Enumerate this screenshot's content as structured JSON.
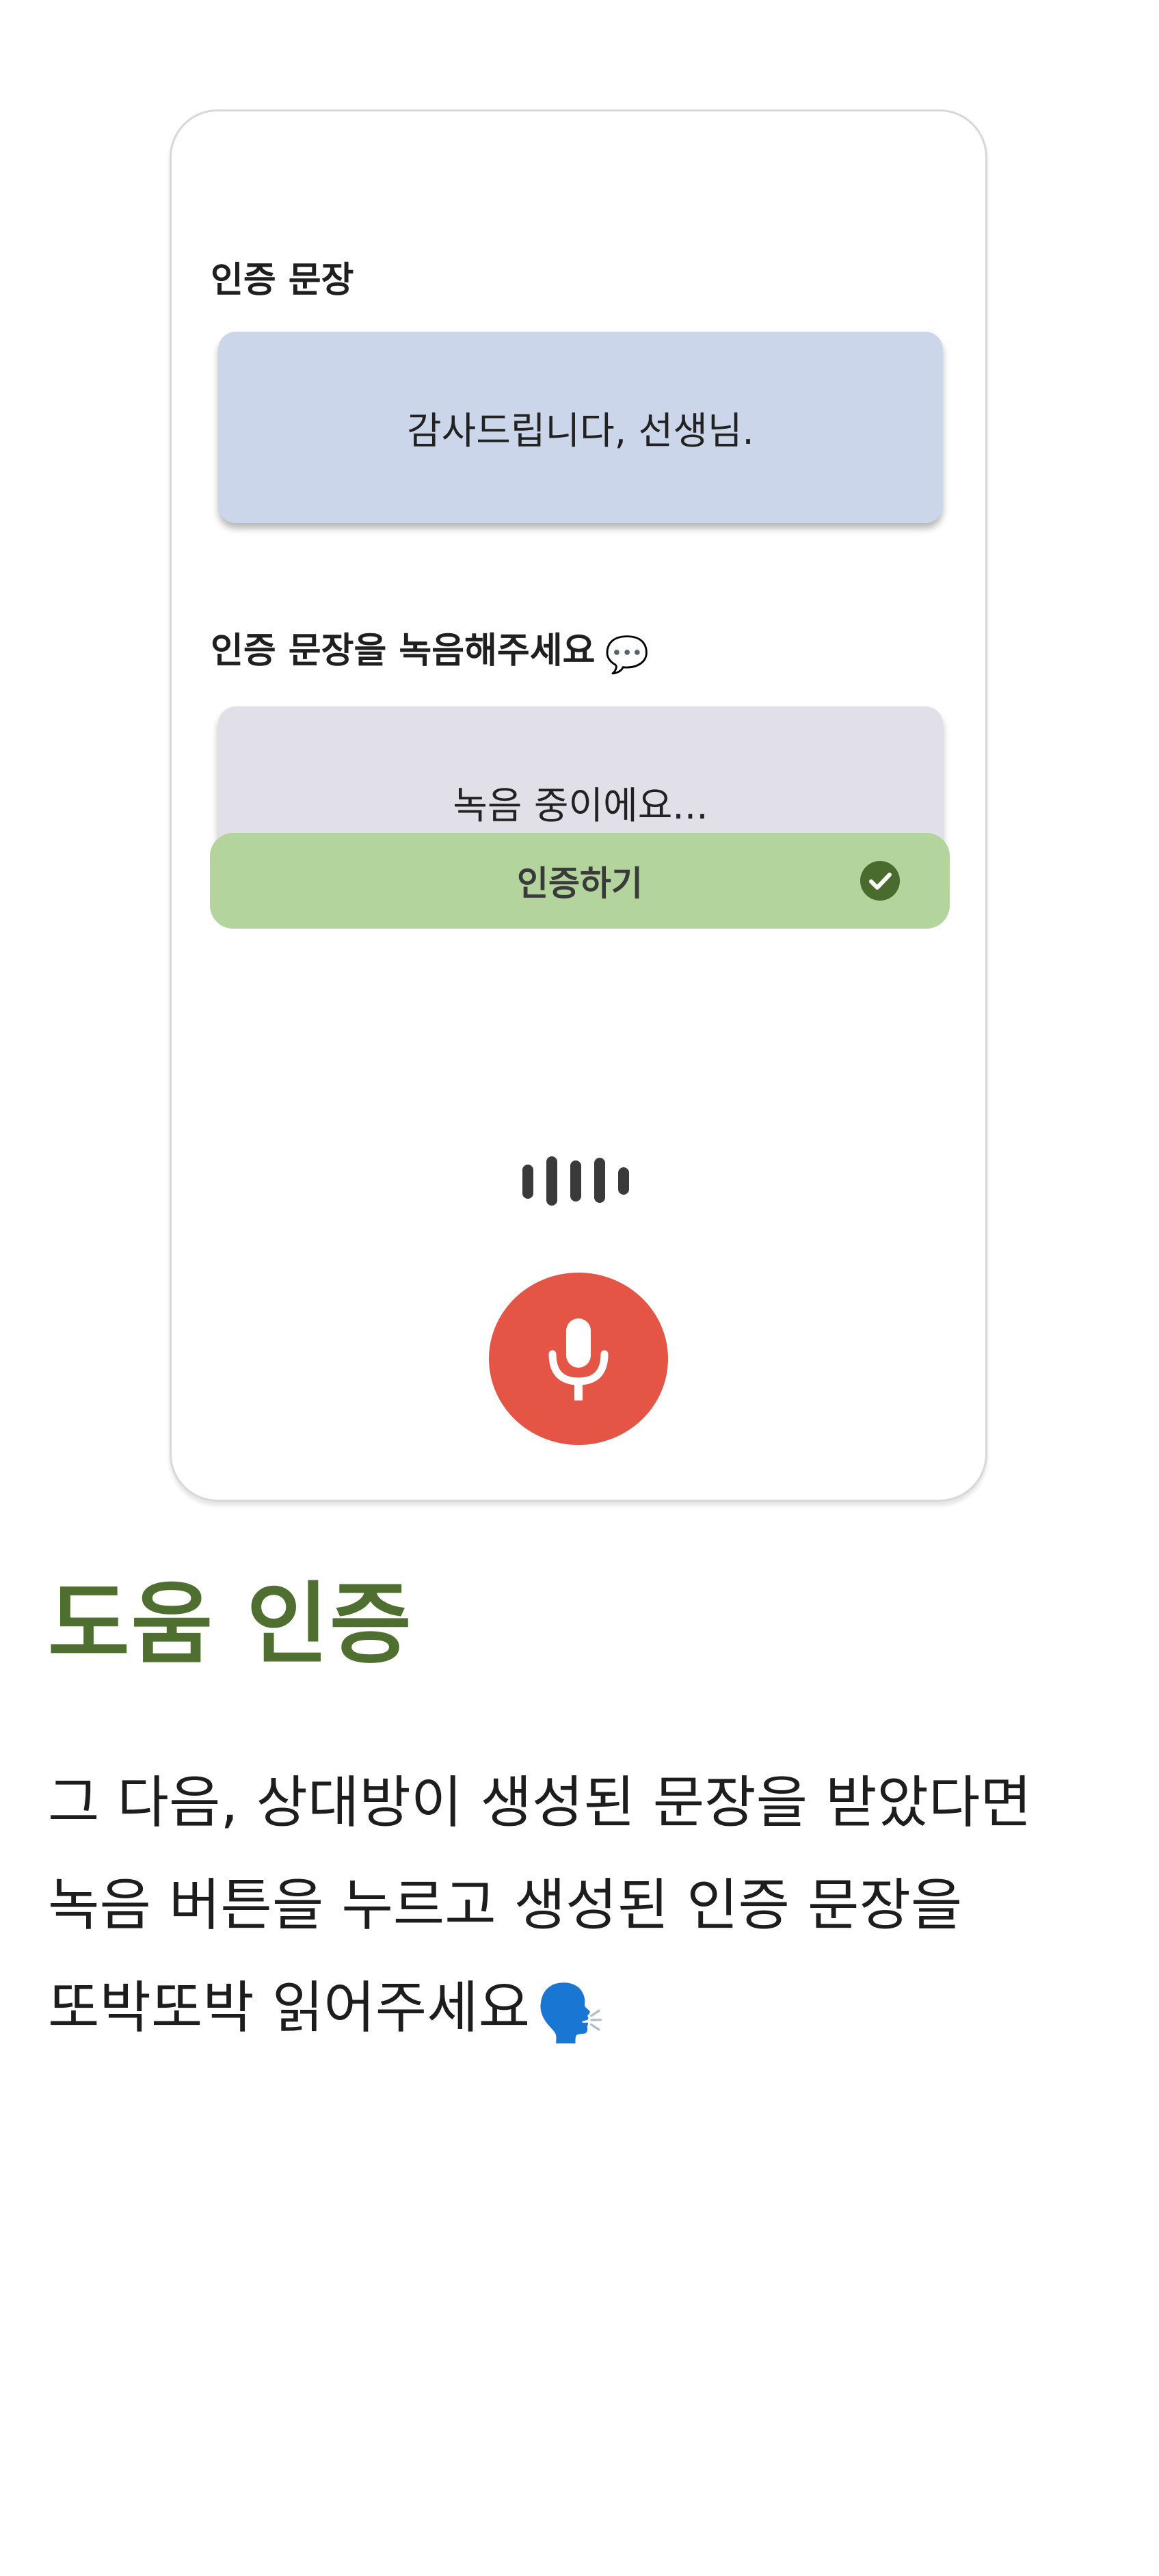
{
  "card": {
    "sentence_label": "인증 문장",
    "sentence_text": "감사드립니다, 선생님.",
    "record_label": "인증 문장을 녹음해주세요",
    "record_label_emoji": "💬",
    "record_status": "녹음 중이에요...",
    "verify_button_label": "인증하기",
    "icons": {
      "verify": "check-circle-icon",
      "wave": "audio-wave-icon",
      "mic": "microphone-icon"
    },
    "colors": {
      "sentence_box": "#cbd6ea",
      "record_box": "#e1e0e9",
      "verify_button": "#b3d49d",
      "mic_button": "#e45545"
    }
  },
  "section": {
    "title": "도움 인증",
    "description_lines": [
      "그 다음, 상대방이 생성된 문장을 받았다면",
      "녹음 버튼을 누르고 생성된 인증 문장을",
      "또박또박 읽어주세요"
    ],
    "description_emoji": "🗣️",
    "title_color": "#4e6f30"
  }
}
